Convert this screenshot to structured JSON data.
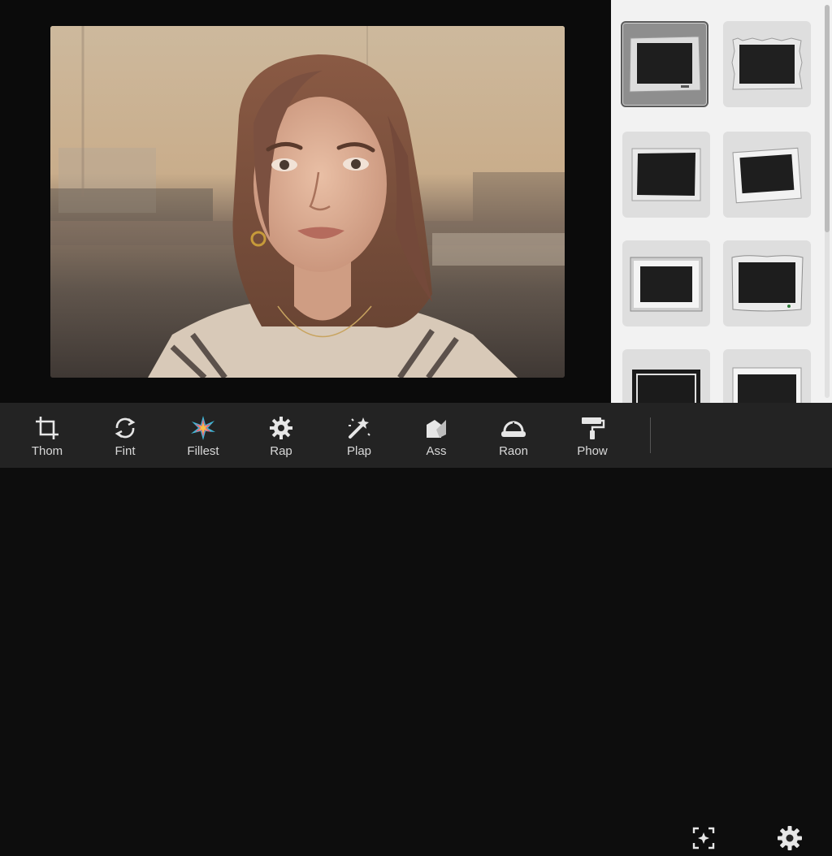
{
  "toolbar": {
    "tools": [
      {
        "label": "Thom",
        "icon": "crop-icon"
      },
      {
        "label": "Fint",
        "icon": "rotate-icon"
      },
      {
        "label": "Fillest",
        "icon": "color-burst-icon"
      },
      {
        "label": "Rap",
        "icon": "gear-icon"
      },
      {
        "label": "Plap",
        "icon": "magic-wand-icon"
      },
      {
        "label": "Ass",
        "icon": "shapes-icon"
      },
      {
        "label": "Raon",
        "icon": "hat-icon"
      },
      {
        "label": "Phow",
        "icon": "paint-roller-icon"
      }
    ],
    "extra": [
      {
        "icon": "sparkle-select-icon"
      },
      {
        "icon": "settings-gear-icon"
      }
    ]
  },
  "frames_panel": {
    "selected_index": 0,
    "frames": [
      {
        "style": "torn-edge-gray"
      },
      {
        "style": "deckle-edge"
      },
      {
        "style": "rough-black-border"
      },
      {
        "style": "tilted-polaroid"
      },
      {
        "style": "metallic-bevel"
      },
      {
        "style": "curled-edge-vintage"
      },
      {
        "style": "double-line-black"
      },
      {
        "style": "thick-white-border"
      }
    ]
  },
  "colors": {
    "toolbar_bg": "#232323",
    "panel_bg": "#f2f2f2",
    "selected_tile": "#8e8e8e"
  }
}
